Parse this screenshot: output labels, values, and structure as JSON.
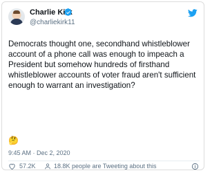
{
  "author": {
    "name": "Charlie Kirk",
    "handle": "@charliekirk11",
    "verified_icon": "verified-badge-icon"
  },
  "brand": {
    "icon": "twitter-bird-icon",
    "color": "#1da1f2"
  },
  "tweet": {
    "text": "Democrats thought one, secondhand whistleblower account of a phone call was enough to impeach a President but somehow hundreds of firsthand whistleblower accounts of voter fraud aren't sufficient enough to warrant an investigation?",
    "emoji": "🤔",
    "timestamp": "9:45 AM · Dec 2, 2020"
  },
  "stats": {
    "likes": "57.2K",
    "tweeting": "18.8K people are Tweeting about this"
  }
}
